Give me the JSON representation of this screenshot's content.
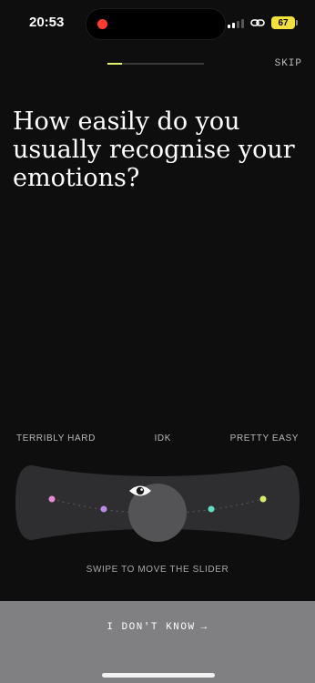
{
  "status_bar": {
    "time": "20:53",
    "battery": "67",
    "recording_indicator_color": "#ff3b30",
    "battery_color": "#f3e13b"
  },
  "header": {
    "progress_fraction": 0.15,
    "progress_color": "#e4ef6a",
    "skip_label": "SKIP"
  },
  "question": "How easily do you usually recognise your emotions?",
  "scale": {
    "labels": [
      "TERRIBLY HARD",
      "IDK",
      "PRETTY EASY"
    ],
    "points": [
      {
        "color": "#e98ad0"
      },
      {
        "color": "#b98ae9"
      },
      {
        "color": "#5de0bf"
      },
      {
        "color": "#d9eb65"
      }
    ],
    "knob_icon": "eye-icon",
    "hint": "SWIPE TO MOVE THE SLIDER"
  },
  "footer": {
    "idk_label": "I DON'T KNOW",
    "idk_arrow": "→"
  }
}
